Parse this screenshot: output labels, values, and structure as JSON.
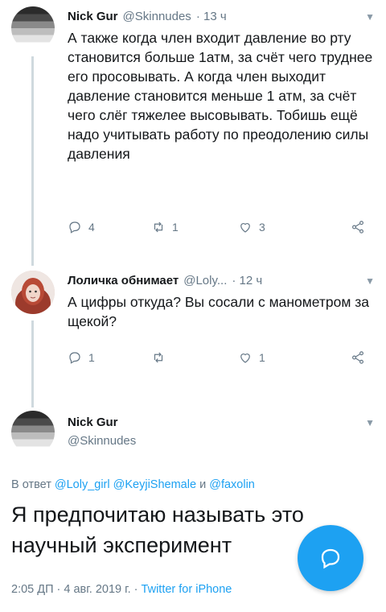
{
  "tweets": [
    {
      "name": "Nick Gur",
      "handle": "@Skinnudes",
      "time": "· 13 ч",
      "text": "А также когда член входит давление во рту становится больше 1атм, за счёт чего труднее его просовывать. А когда член выходит давление становится меньше 1 атм, за счёт чего слёг тяжелее высовывать. Тобишь ещё надо учитывать работу по преодолению силы давления",
      "replies": "4",
      "retweets": "1",
      "likes": "3"
    },
    {
      "name": "Лоличка обнимает",
      "handle": "@Loly...",
      "time": "· 12 ч",
      "text": "А цифры откуда? Вы сосали с манометром за щекой?",
      "replies": "1",
      "retweets": "",
      "likes": "1"
    }
  ],
  "focused": {
    "name": "Nick Gur",
    "handle": "@Skinnudes",
    "reply_prefix": "В ответ",
    "mention1": "@Loly_girl",
    "mention2": "@KeyjiShemale",
    "reply_and": "и",
    "mention3": "@faxolin",
    "text": "Я предпочитаю называть это научный эксперимент",
    "timestamp": "2:05 ДП · 4 авг. 2019 г. · ",
    "client": "Twitter for iPhone"
  },
  "colors": {
    "accent": "#1da1f2",
    "muted": "#657786",
    "text": "#14171a"
  },
  "icons": [
    "reply-icon",
    "retweet-icon",
    "like-icon",
    "share-icon",
    "chevron-down-icon",
    "compose-icon"
  ]
}
